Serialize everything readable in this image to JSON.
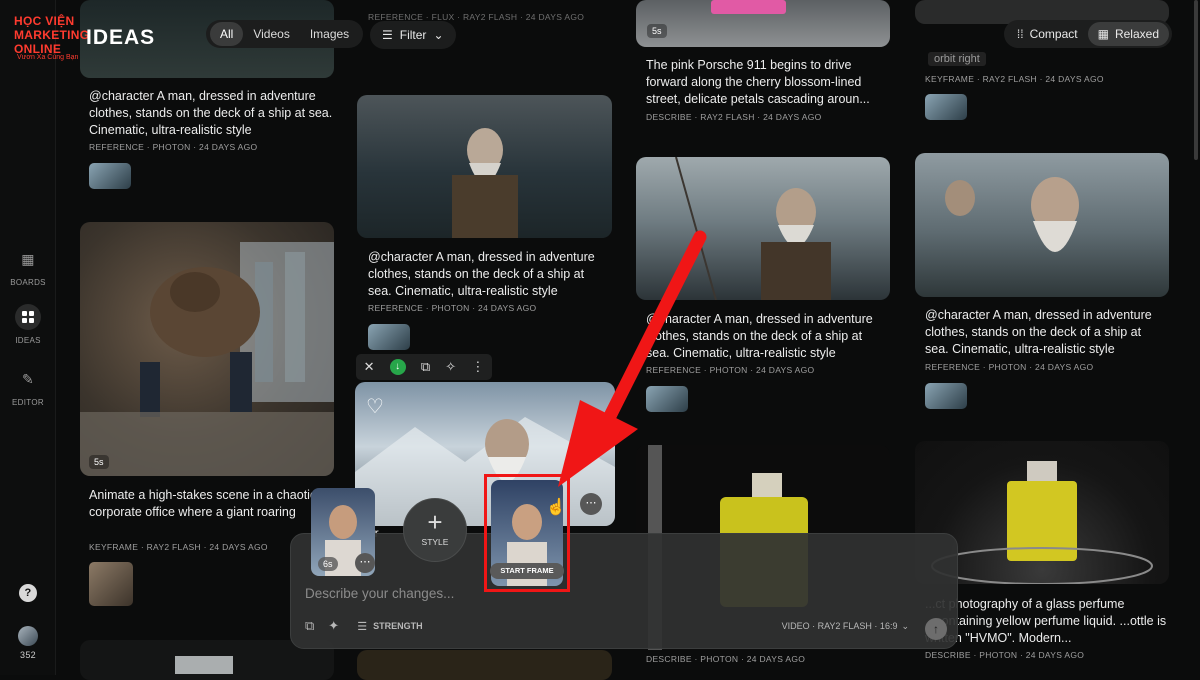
{
  "logo": {
    "brand": "HỌC VIỆN MARKETING ONLINE",
    "slogan": "Vươn Xa Cùng Bạn",
    "product": "IDEAS"
  },
  "filters": {
    "tabs": [
      "All",
      "Videos",
      "Images"
    ],
    "active": "All",
    "filter_label": "Filter"
  },
  "view_toggle": {
    "compact": "Compact",
    "relaxed": "Relaxed",
    "active": "Relaxed"
  },
  "sidebar": {
    "items": [
      {
        "label": "BOARDS",
        "icon": "boards-icon"
      },
      {
        "label": "IDEAS",
        "icon": "grid-icon"
      },
      {
        "label": "EDITOR",
        "icon": "edit-icon"
      }
    ],
    "help": "?",
    "credits": "352"
  },
  "cards": {
    "c1": {
      "caption": "@character A man, dressed in adventure clothes, stands on the deck of a ship at sea. Cinematic, ultra-realistic style",
      "meta": "REFERENCE · PHOTON · 24 DAYS AGO"
    },
    "c2": {
      "caption": "Animate a high-stakes scene in a chaotic corporate office where a giant roaring bear bursts through the wall, sending...",
      "meta": "KEYFRAME · RAY2 FLASH · 24 DAYS AGO",
      "duration": "5s"
    },
    "c3": {
      "caption": "@character A man, dressed in adventure clothes, stands on the deck of a ship at sea. Cinematic, ultra-realistic style",
      "meta": "REFERENCE · PHOTON · 24 DAYS AGO"
    },
    "c4": {
      "caption": "The pink Porsche 911 begins to drive forward along the cherry blossom-lined street, delicate petals cascading aroun...",
      "meta": "DESCRIBE · RAY2 FLASH · 24 DAYS AGO",
      "duration": "5s"
    },
    "c5": {
      "caption": "@character A man, dressed in adventure clothes, stands on the deck of a ship at sea. Cinematic, ultra-realistic style",
      "meta": "REFERENCE · PHOTON · 24 DAYS AGO"
    },
    "c6": {
      "caption": "@character A man, dressed in adventure clothes, stands on the deck of a ship at sea. Cinematic, ultra-realistic style",
      "meta": "REFERENCE · PHOTON · 24 DAYS AGO"
    },
    "c7": {
      "meta": "KEYFRAME · RAY2 FLASH · 24 DAYS AGO",
      "tag": "orbit right"
    },
    "c8": {
      "caption": "...ct photography of a glass perfume ...containing yellow perfume liquid. ...ottle is written \"HVMO\". Modern...",
      "meta": "DESCRIBE · PHOTON · 24 DAYS AGO"
    },
    "c9": {
      "meta": "DESCRIBE · PHOTON · 24 DAYS AGO"
    },
    "top_meta": "REFERENCE · FLUX · RAY2 FLASH · 24 DAYS AGO"
  },
  "prompt": {
    "placeholder": "Describe your changes...",
    "style_label": "STYLE",
    "start_frame": "START FRAME",
    "ref_duration": "6s",
    "strength": "STRENGTH",
    "model_info": "VIDEO · RAY2 FLASH · 16:9"
  },
  "colors": {
    "accent_red": "#f01616",
    "background": "#0b0c0c",
    "panel": "#303232"
  }
}
